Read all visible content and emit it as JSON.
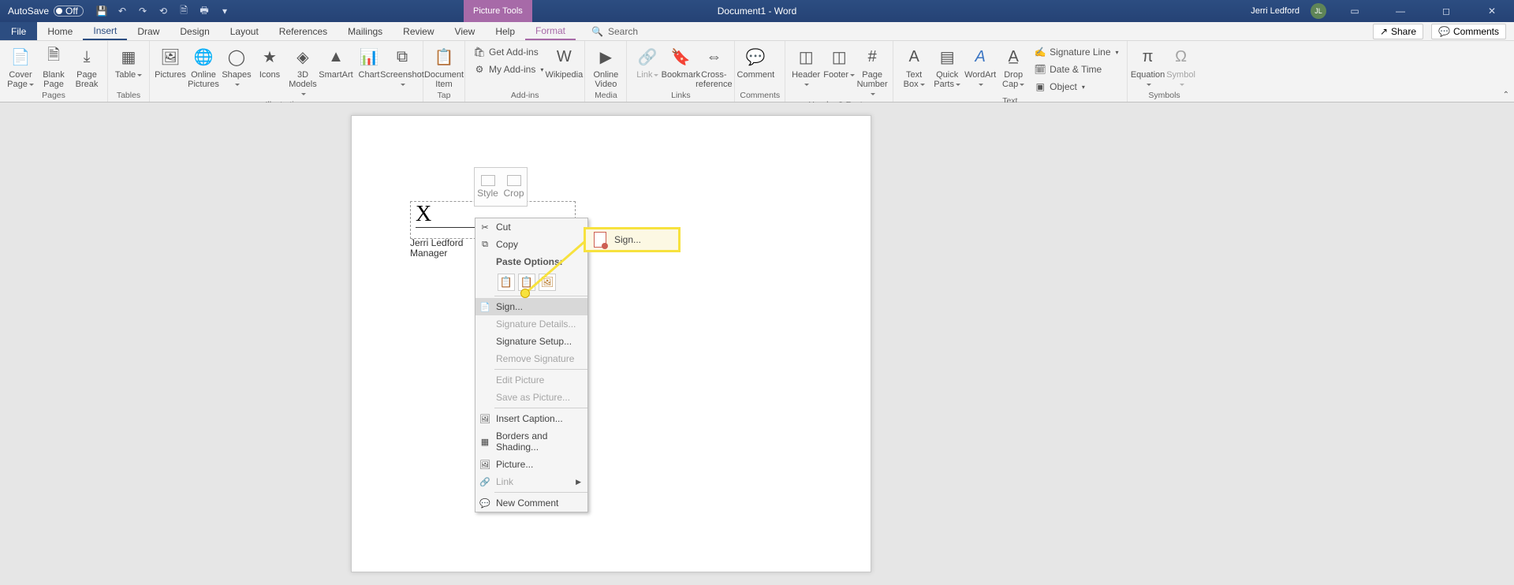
{
  "titlebar": {
    "autosave_label": "AutoSave",
    "autosave_state": "Off",
    "context_tool": "Picture Tools",
    "doc_title": "Document1  -  Word",
    "user_name": "Jerri Ledford",
    "user_initials": "JL"
  },
  "tabs": {
    "file": "File",
    "list": [
      "Home",
      "Insert",
      "Draw",
      "Design",
      "Layout",
      "References",
      "Mailings",
      "Review",
      "View",
      "Help"
    ],
    "context_tab": "Format",
    "search_placeholder": "Search",
    "share": "Share",
    "comments": "Comments"
  },
  "ribbon": {
    "pages": {
      "cover": "Cover Page",
      "blank": "Blank Page",
      "break": "Page Break",
      "label": "Pages"
    },
    "tables": {
      "table": "Table",
      "label": "Tables"
    },
    "illus": {
      "pictures": "Pictures",
      "online": "Online Pictures",
      "shapes": "Shapes",
      "icons": "Icons",
      "models": "3D Models",
      "smartart": "SmartArt",
      "chart": "Chart",
      "screenshot": "Screenshot",
      "label": "Illustrations"
    },
    "tap": {
      "doc": "Document Item",
      "label": "Tap"
    },
    "addins": {
      "get": "Get Add-ins",
      "my": "My Add-ins",
      "wiki": "Wikipedia",
      "label": "Add-ins"
    },
    "media": {
      "video": "Online Video",
      "label": "Media"
    },
    "links": {
      "link": "Link",
      "bookmark": "Bookmark",
      "xref": "Cross-reference",
      "label": "Links"
    },
    "comments": {
      "comment": "Comment",
      "label": "Comments"
    },
    "hf": {
      "header": "Header",
      "footer": "Footer",
      "page": "Page Number",
      "label": "Header & Footer"
    },
    "text": {
      "box": "Text Box",
      "quick": "Quick Parts",
      "wordart": "WordArt",
      "drop": "Drop Cap",
      "sig": "Signature Line",
      "date": "Date & Time",
      "obj": "Object",
      "label": "Text"
    },
    "symbols": {
      "eq": "Equation",
      "sym": "Symbol",
      "label": "Symbols"
    }
  },
  "signature": {
    "x": "X",
    "name": "Jerri Ledford",
    "role": "Manager"
  },
  "mini_toolbar": {
    "style": "Style",
    "crop": "Crop"
  },
  "ctx": {
    "cut": "Cut",
    "copy": "Copy",
    "paste_label": "Paste Options:",
    "sign": "Sign...",
    "details": "Signature Details...",
    "setup": "Signature Setup...",
    "remove": "Remove Signature",
    "edit": "Edit Picture",
    "saveas": "Save as Picture...",
    "caption": "Insert Caption...",
    "borders": "Borders and Shading...",
    "picture": "Picture...",
    "link": "Link",
    "newc": "New Comment"
  },
  "callout": {
    "label": "Sign..."
  }
}
